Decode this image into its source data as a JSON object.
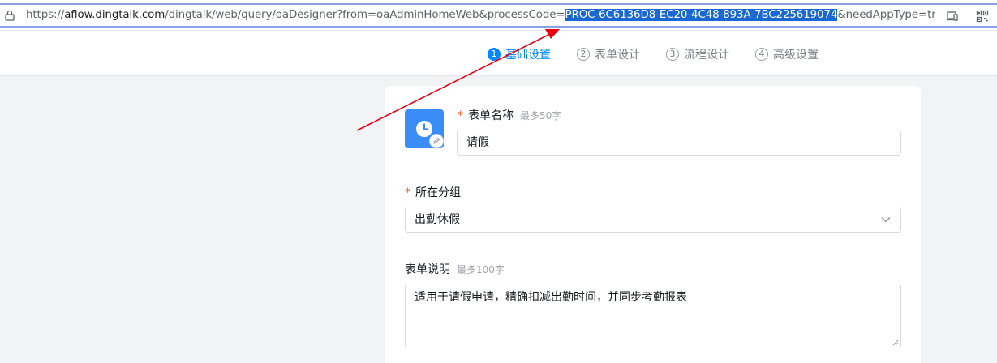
{
  "browser": {
    "url_prefix": "https://",
    "url_host": "aflow.dingtalk.com",
    "url_path": "/dingtalk/web/query/oaDesigner?from=oaAdminHomeWeb&processCode=",
    "url_highlight": "PROC-6C6136D8-EC20-4C48-893A-7BC225619074",
    "url_suffix": "&needAppType=true&appTy"
  },
  "steps": [
    {
      "num": "1",
      "label": "基础设置"
    },
    {
      "num": "2",
      "label": "表单设计"
    },
    {
      "num": "3",
      "label": "流程设计"
    },
    {
      "num": "4",
      "label": "高级设置"
    }
  ],
  "form": {
    "name_label": "表单名称",
    "name_hint": "最多50字",
    "name_value": "请假",
    "group_label": "所在分组",
    "group_value": "出勤休假",
    "desc_label": "表单说明",
    "desc_hint": "最多100字",
    "desc_value": "适用于请假申请，精确扣减出勤时间，并同步考勤报表",
    "required_mark": "*"
  },
  "colors": {
    "accent": "#0089ff",
    "required": "#ff5219",
    "annotation_arrow": "#e60012",
    "url_highlight": "#1967d2"
  },
  "icons": [
    "lock-icon",
    "cast-icon",
    "qr-code-icon",
    "clock-icon",
    "edit-icon",
    "chevron-down-icon"
  ]
}
